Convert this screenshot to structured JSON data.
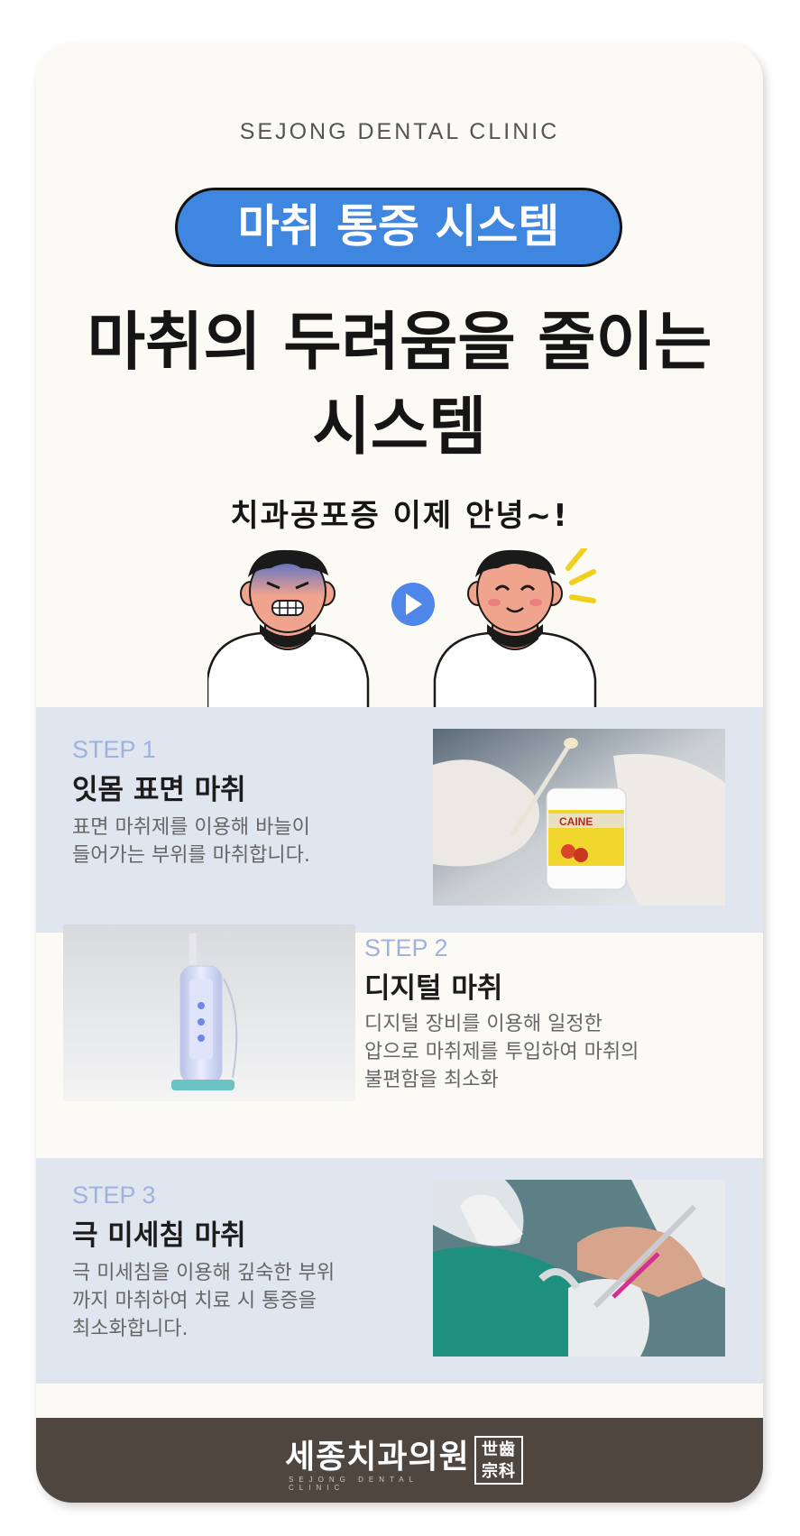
{
  "header": {
    "clinic_name": "SEJONG DENTAL CLINIC",
    "badge": "마취 통증 시스템",
    "headline_line1": "마취의 두려움을 줄이는",
    "headline_line2": "시스템",
    "handwritten_tagline": "치과공포증 이제 안녕~!"
  },
  "illustration": {
    "before": "scared-patient-icon",
    "arrow": "play-arrow-icon",
    "after": "happy-patient-icon"
  },
  "steps": [
    {
      "label": "STEP 1",
      "title": "잇몸 표면 마취",
      "desc_line1": "표면 마취제를 이용해 바늘이",
      "desc_line2": "들어가는 부위를 마취합니다.",
      "photo": "topical-anesthetic-gel-photo",
      "photo_product_text": "CAINE"
    },
    {
      "label": "STEP 2",
      "title": "디지털 마취",
      "desc_line1": "디지털 장비를 이용해 일정한",
      "desc_line2": "압으로 마취제를 투입하여 마취의",
      "desc_line3": "불편함을 최소화",
      "photo": "digital-anesthesia-device-photo"
    },
    {
      "label": "STEP 3",
      "title": "극 미세침 마취",
      "desc_line1": "극 미세침을 이용해 깊숙한 부위",
      "desc_line2": "까지 마취하여 치료 시 통증을",
      "desc_line3": "최소화합니다.",
      "photo": "dental-injection-photo"
    }
  ],
  "footer": {
    "logo_text": "세종치과의원",
    "logo_subtext": "SEJONG DENTAL CLINIC",
    "seal_line1": "世齒",
    "seal_line2": "宗科"
  },
  "colors": {
    "accent_blue": "#3e86e0",
    "card_background": "#fcfaf5",
    "step_band": "#dfe6ef",
    "step_label": "#9fb2dd",
    "footer_brown": "#4f4640"
  }
}
